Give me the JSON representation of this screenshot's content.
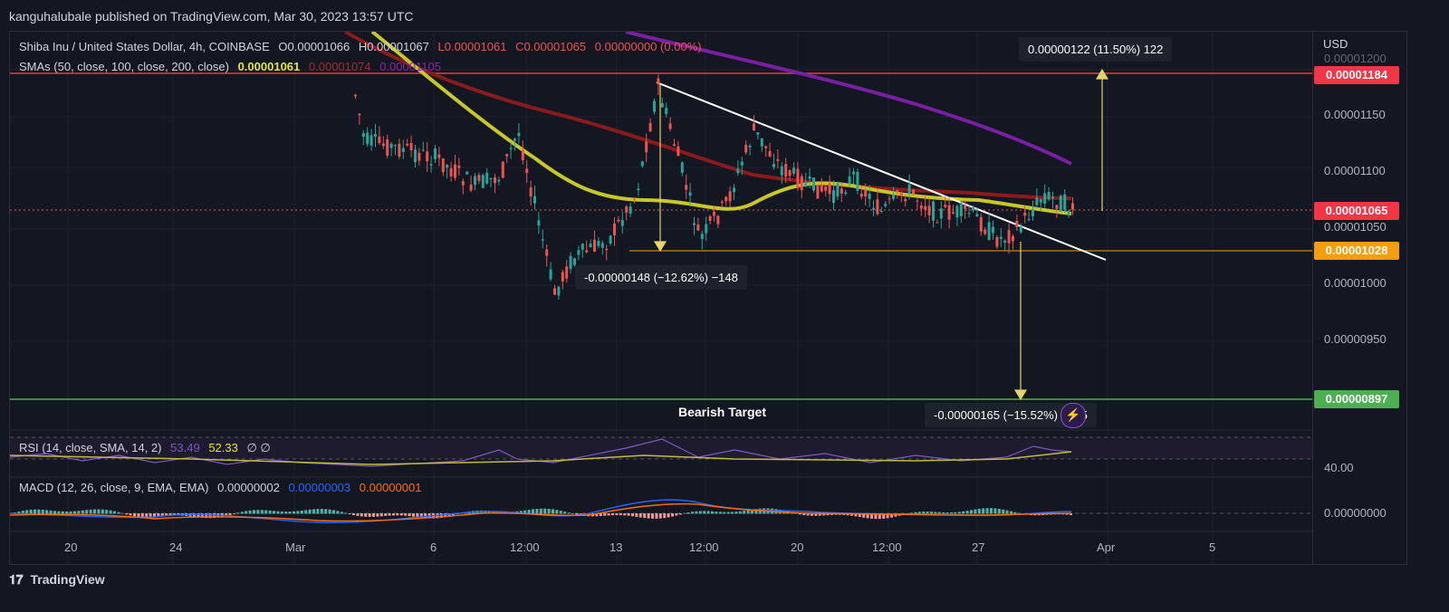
{
  "header": {
    "published": "kanguhalubale published on TradingView.com, Mar 30, 2023 13:57 UTC"
  },
  "legend": {
    "symbol": "Shiba Inu / United States Dollar, 4h, COINBASE",
    "open": "O0.00001066",
    "high": "H0.00001067",
    "low": "L0.00001061",
    "close": "C0.00001065",
    "change": "0.00000000 (0.00%)",
    "sma_label": "SMAs (50, close, 100, close, 200, close)",
    "sma50": "0.00001061",
    "sma100": "0.00001074",
    "sma200": "0.00001105"
  },
  "axis": {
    "currency": "USD",
    "ticks": [
      "0.00001200",
      "0.00001150",
      "0.00001100",
      "0.00001050",
      "0.00001000",
      "0.00000950"
    ],
    "badges": {
      "resistance": "0.00001184",
      "last": "0.00001065",
      "support": "0.00001028",
      "target": "0.00000897"
    },
    "rsi_tick": "40.00",
    "macd_tick": "0.00000000"
  },
  "dates": [
    "20",
    "24",
    "Mar",
    "6",
    "12:00",
    "13",
    "12:00",
    "20",
    "12:00",
    "27",
    "Apr",
    "5"
  ],
  "annotations": {
    "up": "0.00000122 (11.50%) 122",
    "drop": "-0.00000148 (−12.62%) −148",
    "target": "-0.00000165 (−15.52%) −165",
    "bearish": "Bearish Target"
  },
  "rsi": {
    "label": "RSI (14, close, SMA, 14, 2)",
    "value": "53.49",
    "sma": "52.33",
    "extra": "∅ ∅"
  },
  "macd": {
    "label": "MACD (12, 26, close, 9, EMA, EMA)",
    "macd": "0.00000002",
    "signal": "0.00000003",
    "hist": "0.00000001"
  },
  "footer": {
    "brand": "TradingView"
  },
  "colors": {
    "bg": "#131722",
    "up": "#26a69a",
    "down": "#ef5350",
    "sma50": "#c7c72a",
    "sma100": "#8b1a1a",
    "sma200": "#7b1fa2",
    "resistance": "#f23645",
    "support": "#f59d0c",
    "target": "#4caf50"
  }
}
